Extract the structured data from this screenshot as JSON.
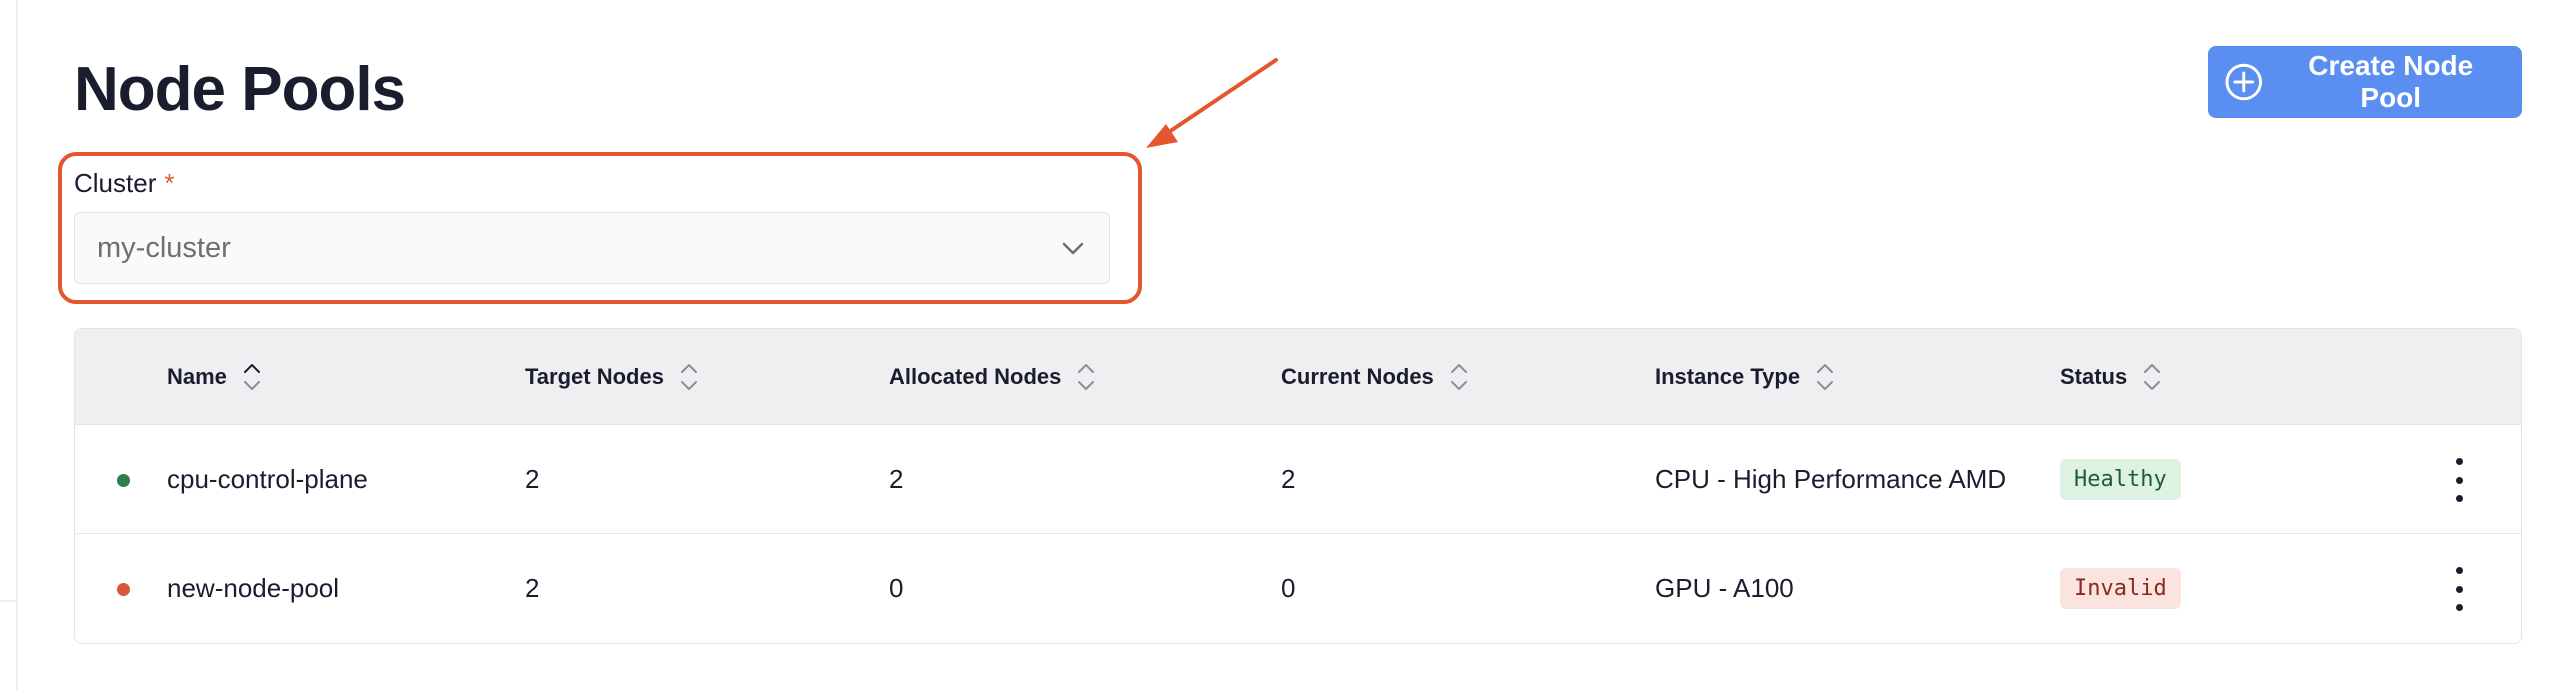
{
  "page": {
    "title": "Node Pools",
    "create_button_label": "Create Node Pool"
  },
  "cluster_field": {
    "label": "Cluster",
    "required_marker": "*",
    "value": "my-cluster"
  },
  "table": {
    "columns": [
      {
        "label": "Name"
      },
      {
        "label": "Target Nodes"
      },
      {
        "label": "Allocated Nodes"
      },
      {
        "label": "Current Nodes"
      },
      {
        "label": "Instance Type"
      },
      {
        "label": "Status"
      }
    ],
    "rows": [
      {
        "status_dot_color": "#2e7d4f",
        "name": "cpu-control-plane",
        "target_nodes": "2",
        "allocated_nodes": "2",
        "current_nodes": "2",
        "instance_type": "CPU - High Performance AMD",
        "status": "Healthy"
      },
      {
        "status_dot_color": "#d9573b",
        "name": "new-node-pool",
        "target_nodes": "2",
        "allocated_nodes": "0",
        "current_nodes": "0",
        "instance_type": "GPU - A100",
        "status": "Invalid"
      }
    ]
  },
  "colors": {
    "accent": "#5a8ef0",
    "annotation": "#e4572e",
    "healthy_bg": "#ddf2e3",
    "invalid_bg": "#fbe3df"
  },
  "icons": {
    "create_button": "plus-circle-icon",
    "select": "chevron-down-icon",
    "sort": "sort-icon",
    "row_menu": "kebab-menu-icon"
  }
}
